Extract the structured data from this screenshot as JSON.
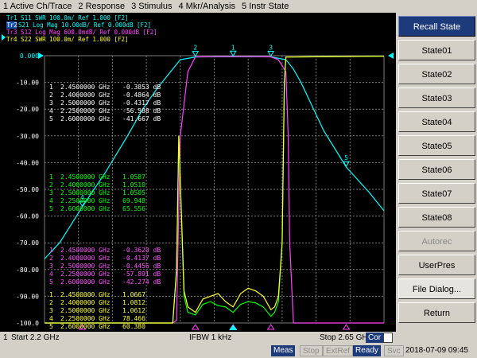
{
  "menubar": [
    "1 Active Ch/Trace",
    "2 Response",
    "3 Stimulus",
    "4 Mkr/Analysis",
    "5 Instr State"
  ],
  "traces": [
    {
      "label": "Tr1 S11 SWR 100.0m/ Ref 1.000 [F2]",
      "color": "#00ffff"
    },
    {
      "label": "S21 Log Mag 10.00dB/ Ref 0.000dB [F2]",
      "color": "#00ffff",
      "active_tag": "Tr2"
    },
    {
      "label": "Tr3 S12 Log Mag 600.0mdB/ Ref 0.000dB [F2]",
      "color": "#ff44ff"
    },
    {
      "label": "Tr4 S22 SWR 100.0m/ Ref 1.000 [F2]",
      "color": "#ffff00"
    }
  ],
  "colors": {
    "s21": "#00ffff",
    "s12": "#ff44ff",
    "s11": "#00ff00",
    "s22": "#ffff33",
    "graticule": "#7a7a7a"
  },
  "y_scale": {
    "ticks": [
      "0.000",
      "-10.00",
      "-20.00",
      "-30.00",
      "-40.00",
      "-50.00",
      "-60.00",
      "-70.00",
      "-80.00",
      "-90.00",
      "-100.0"
    ]
  },
  "marker_tables": [
    {
      "color": "#ffffff",
      "rows": [
        {
          "n": "1",
          "freq": "2.4500000 GHz",
          "val": "-0.3853 dB"
        },
        {
          "n": "2",
          "freq": "2.4000000 GHz",
          "val": "-0.4864 dB"
        },
        {
          "n": "3",
          "freq": "2.5000000 GHz",
          "val": "-0.4317 dB"
        },
        {
          "n": "4",
          "freq": "2.2500000 GHz",
          "val": "-56.588 dB"
        },
        {
          "n": "5",
          "freq": "2.6000000 GHz",
          "val": "-41.667 dB"
        }
      ]
    },
    {
      "color": "#00ff00",
      "rows": [
        {
          "n": "1",
          "freq": "2.4500000 GHz",
          "val": "1.0587"
        },
        {
          "n": "2",
          "freq": "2.4000000 GHz",
          "val": "1.0510"
        },
        {
          "n": "3",
          "freq": "2.5000000 GHz",
          "val": "1.0505"
        },
        {
          "n": "4",
          "freq": "2.2500000 GHz",
          "val": "69.948"
        },
        {
          "n": "5",
          "freq": "2.6000000 GHz",
          "val": "65.556"
        }
      ]
    },
    {
      "color": "#ff55ff",
      "rows": [
        {
          "n": "1",
          "freq": "2.4500000 GHz",
          "val": "-0.3620 dB"
        },
        {
          "n": "2",
          "freq": "2.4000000 GHz",
          "val": "-0.4137 dB"
        },
        {
          "n": "3",
          "freq": "2.5000000 GHz",
          "val": "-0.4456 dB"
        },
        {
          "n": "4",
          "freq": "2.2500000 GHz",
          "val": "-57.891 dB"
        },
        {
          "n": "5",
          "freq": "2.6000000 GHz",
          "val": "-42.274 dB"
        }
      ]
    },
    {
      "color": "#ffff33",
      "rows": [
        {
          "n": "1",
          "freq": "2.4500000 GHz",
          "val": "1.0667"
        },
        {
          "n": "2",
          "freq": "2.4000000 GHz",
          "val": "1.0812"
        },
        {
          "n": "3",
          "freq": "2.5000000 GHz",
          "val": "1.0612"
        },
        {
          "n": "4",
          "freq": "2.2500000 GHz",
          "val": "78.466"
        },
        {
          "n": "5",
          "freq": "2.6000000 GHz",
          "val": "60.380"
        }
      ]
    }
  ],
  "chart_data": {
    "type": "line",
    "x_range_ghz": [
      2.2,
      2.65
    ],
    "y_range_db": [
      -100,
      0
    ],
    "grid": true,
    "series": [
      {
        "name": "S21",
        "color": "#00ffff",
        "x": [
          2.2,
          2.22,
          2.25,
          2.28,
          2.31,
          2.33,
          2.35,
          2.37,
          2.38,
          2.4,
          2.45,
          2.5,
          2.52,
          2.53,
          2.54,
          2.55,
          2.57,
          2.6,
          2.63,
          2.65
        ],
        "y": [
          -76,
          -70,
          -56.6,
          -44,
          -30,
          -20,
          -12,
          -5,
          -1.5,
          -0.49,
          -0.39,
          -0.43,
          -1.5,
          -5,
          -10,
          -16,
          -28,
          -41.7,
          -51,
          -58
        ]
      },
      {
        "name": "S12",
        "color": "#ff44ff",
        "x": [
          2.2,
          2.37,
          2.375,
          2.377,
          2.38,
          2.39,
          2.4,
          2.42,
          2.43,
          2.45,
          2.47,
          2.48,
          2.5,
          2.51,
          2.52,
          2.523,
          2.525,
          2.53,
          2.65
        ],
        "y": [
          -100,
          -100,
          -99,
          -70,
          -30,
          -6,
          -0.41,
          -0.4,
          -0.35,
          -0.36,
          -0.35,
          -0.4,
          -0.45,
          -1.5,
          -6,
          -30,
          -70,
          -100,
          -100
        ]
      },
      {
        "name": "S11",
        "color": "#00ff00",
        "x": [
          2.2,
          2.37,
          2.375,
          2.378,
          2.385,
          2.39,
          2.4,
          2.41,
          2.42,
          2.43,
          2.44,
          2.45,
          2.46,
          2.47,
          2.48,
          2.49,
          2.5,
          2.505,
          2.51,
          2.515,
          2.518,
          2.52,
          2.65
        ],
        "y": [
          -100,
          -100,
          -80,
          -30,
          -90,
          -96,
          -97,
          -93,
          -92,
          -93.5,
          -94,
          -96,
          -93,
          -92,
          -92.5,
          -94,
          -97.5,
          -96,
          -92,
          -70,
          -10,
          -0.5,
          -0.2
        ]
      },
      {
        "name": "S22",
        "color": "#ffff33",
        "x": [
          2.2,
          2.37,
          2.375,
          2.378,
          2.385,
          2.39,
          2.4,
          2.41,
          2.42,
          2.43,
          2.44,
          2.45,
          2.46,
          2.47,
          2.48,
          2.49,
          2.5,
          2.505,
          2.51,
          2.515,
          2.518,
          2.52,
          2.65
        ],
        "y": [
          -100,
          -100,
          -80,
          -30,
          -88,
          -94,
          -96,
          -91,
          -90,
          -89,
          -92,
          -94,
          -89,
          -87,
          -88,
          -90,
          -95,
          -94,
          -90,
          -70,
          -10,
          -0.5,
          -0.2
        ]
      }
    ],
    "markers": [
      {
        "n": "1",
        "x": 2.45,
        "y": -0.39
      },
      {
        "n": "2",
        "x": 2.4,
        "y": -0.49
      },
      {
        "n": "3",
        "x": 2.5,
        "y": -0.43
      },
      {
        "n": "4",
        "x": 2.25,
        "y": -56.6
      },
      {
        "n": "5",
        "x": 2.6,
        "y": -41.7
      }
    ]
  },
  "softkeys": [
    {
      "label": "Recall State",
      "kind": "title"
    },
    {
      "label": "State01",
      "kind": "normal"
    },
    {
      "label": "State02",
      "kind": "normal"
    },
    {
      "label": "State03",
      "kind": "normal"
    },
    {
      "label": "State04",
      "kind": "normal"
    },
    {
      "label": "State05",
      "kind": "normal"
    },
    {
      "label": "State06",
      "kind": "normal"
    },
    {
      "label": "State07",
      "kind": "normal"
    },
    {
      "label": "State08",
      "kind": "normal"
    },
    {
      "label": "Autorec",
      "kind": "disabled"
    },
    {
      "label": "UserPres",
      "kind": "normal"
    },
    {
      "label": "File Dialog...",
      "kind": "sel"
    },
    {
      "label": "Return",
      "kind": "normal"
    }
  ],
  "bottombar": {
    "channel": "1",
    "start": "Start 2.2 GHz",
    "ifbw": "IFBW 1 kHz",
    "stop": "Stop 2.65 GHz",
    "cor": "Cor"
  },
  "statusbar": {
    "meas": "Meas",
    "stop": "Stop",
    "extref": "ExtRef",
    "ready": "Ready",
    "svc": "Svc",
    "datetime": "2018-07-09 09:45"
  }
}
